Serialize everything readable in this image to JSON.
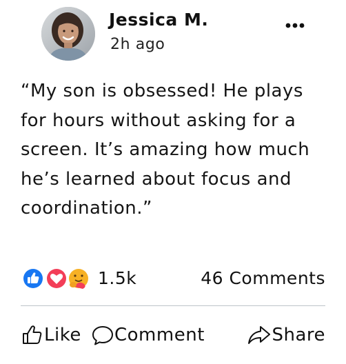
{
  "post": {
    "author": "Jessica M.",
    "time": "2h ago",
    "text": "“My son is obsessed! He plays for hours without asking for a screen. It’s amazing how much he’s learned about focus and coordination.”"
  },
  "reactions": {
    "icons": [
      "like-icon",
      "love-icon",
      "care-icon"
    ],
    "count": "1.5k",
    "comments": "46 Comments"
  },
  "actions": {
    "like": "Like",
    "comment": "Comment",
    "share": "Share"
  },
  "colors": {
    "like_blue": "#1877F2",
    "love_red": "#F33E58",
    "care_yellow": "#F7B125",
    "divider": "#BCC3C9"
  }
}
